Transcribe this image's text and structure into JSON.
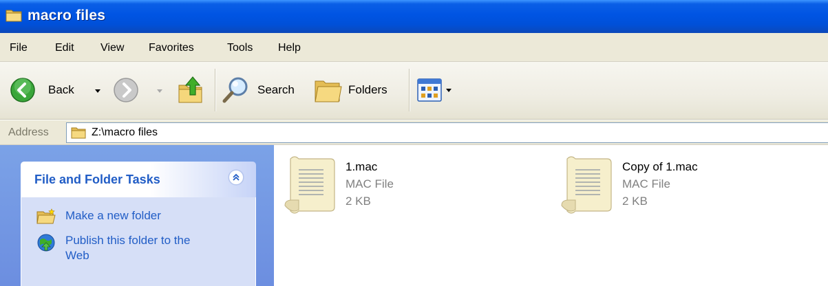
{
  "window": {
    "title": "macro files"
  },
  "menu": {
    "items": [
      "File",
      "Edit",
      "View",
      "Favorites",
      "Tools",
      "Help"
    ]
  },
  "toolbar": {
    "back_label": "Back",
    "search_label": "Search",
    "folders_label": "Folders"
  },
  "address": {
    "label": "Address",
    "path": "Z:\\macro files"
  },
  "tasks": {
    "title": "File and Folder Tasks",
    "links": [
      {
        "label": "Make a new folder",
        "icon": "new-folder-icon"
      },
      {
        "label_line1": "Publish this folder to the",
        "label_line2": "Web",
        "icon": "publish-web-icon"
      }
    ]
  },
  "files": [
    {
      "name": "1.mac",
      "type": "MAC File",
      "size": "2 KB"
    },
    {
      "name": "Copy of 1.mac",
      "type": "MAC File",
      "size": "2 KB"
    }
  ],
  "colors": {
    "titlebar": "#0054e3",
    "taskpane": "#7ba2e7",
    "link": "#215dc6"
  }
}
